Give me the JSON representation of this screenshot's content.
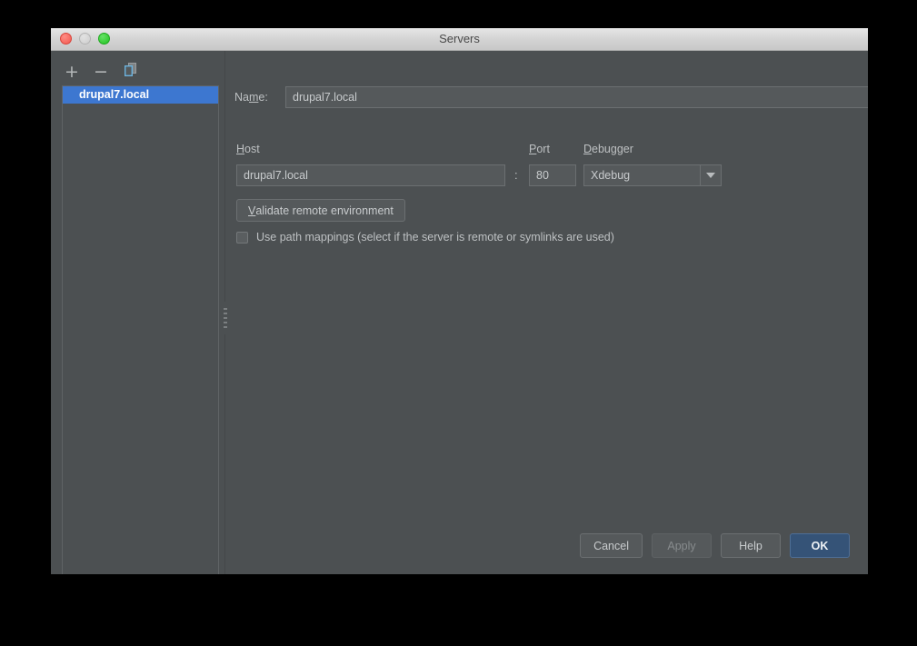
{
  "window": {
    "title": "Servers",
    "traffic_lights": [
      "close-button",
      "minimize-button",
      "zoom-button"
    ]
  },
  "sidebar": {
    "toolbar": {
      "add_label": "+",
      "remove_label": "−",
      "copy_label": "copy-icon"
    },
    "items": [
      {
        "label": "drupal7.local",
        "selected": true
      }
    ]
  },
  "form": {
    "name": {
      "label_pre": "Na",
      "label_mn": "m",
      "label_post": "e:",
      "value": "drupal7.local"
    },
    "host": {
      "label_mn": "H",
      "label_post": "ost",
      "value": "drupal7.local"
    },
    "separator": ":",
    "port": {
      "label_mn": "P",
      "label_post": "ort",
      "value": "80"
    },
    "debugger": {
      "label_mn": "D",
      "label_post": "ebugger",
      "value": "Xdebug",
      "options": [
        "Xdebug"
      ]
    },
    "validate_button": {
      "label_mn": "V",
      "label_post": "alidate remote environment"
    },
    "path_mappings": {
      "label": "Use path mappings (select if the server is remote or symlinks are used)",
      "checked": false
    }
  },
  "footer": {
    "cancel_label": "Cancel",
    "apply_label": "Apply",
    "help_label": "Help",
    "ok_label": "OK"
  },
  "colors": {
    "window_bg": "#4c5052",
    "titlebar_bg": "#d4d4d4",
    "selection_blue": "#3d77d0",
    "primary_button": "#355377",
    "field_bg": "#55595b",
    "text": "#bdc0c2"
  }
}
